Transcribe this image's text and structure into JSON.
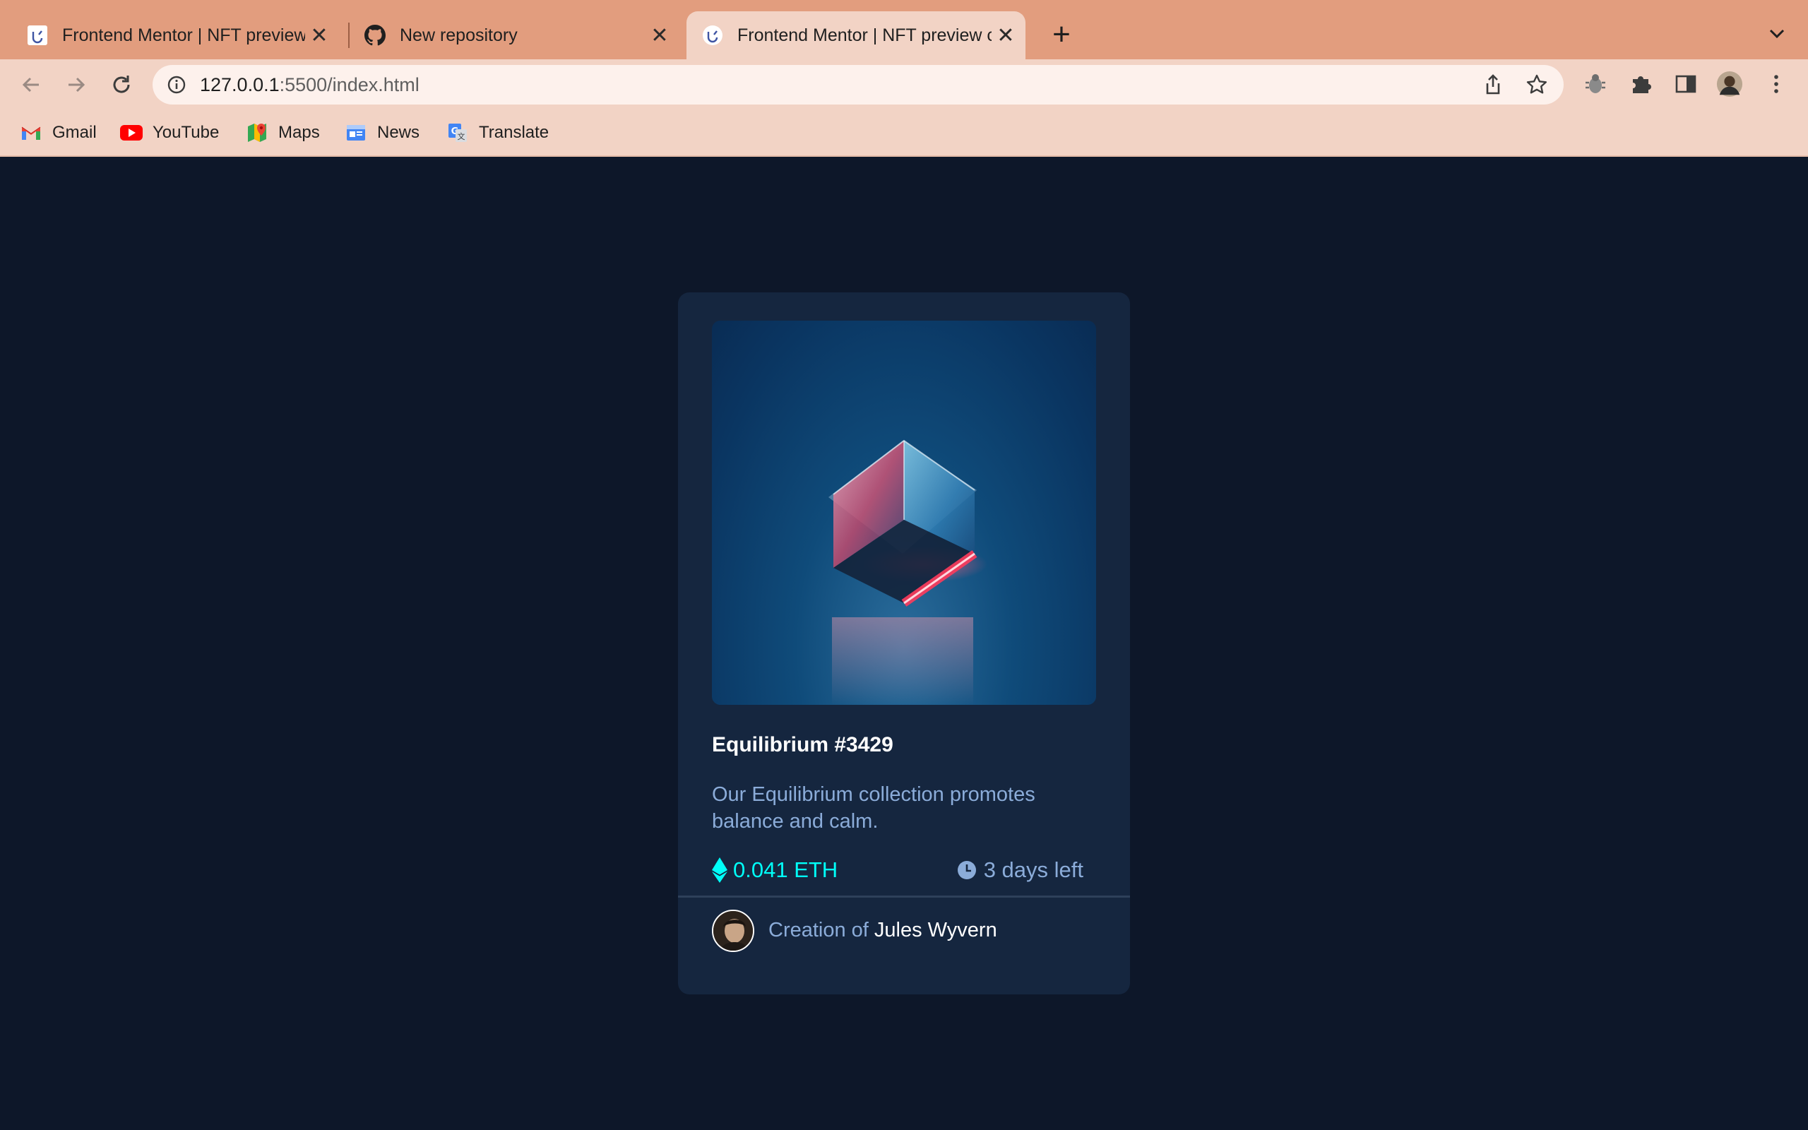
{
  "browser": {
    "tabs": [
      {
        "title": "Frontend Mentor | NFT preview card component",
        "active": false,
        "favicon": "frontend-mentor-icon"
      },
      {
        "title": "New repository",
        "active": false,
        "favicon": "github-icon"
      },
      {
        "title": "Frontend Mentor | NFT preview card component",
        "active": true,
        "favicon": "frontend-mentor-icon"
      }
    ],
    "url_host": "127.0.0.1",
    "url_rest": ":5500/index.html",
    "bookmarks": [
      {
        "label": "Gmail",
        "icon": "gmail-icon"
      },
      {
        "label": "YouTube",
        "icon": "youtube-icon"
      },
      {
        "label": "Maps",
        "icon": "maps-icon"
      },
      {
        "label": "News",
        "icon": "news-icon"
      },
      {
        "label": "Translate",
        "icon": "translate-icon"
      }
    ],
    "colors": {
      "frame": "#e29d7e",
      "toolbar": "#f2d3c5"
    }
  },
  "card": {
    "title": "Equilibrium #3429",
    "description": "Our Equilibrium collection promotes balance and calm.",
    "price": "0.041 ETH",
    "time_left": "3 days left",
    "creation_prefix": "Creation of",
    "creator_name": "Jules Wyvern",
    "colors": {
      "page_bg": "#0d1729",
      "card_bg": "#15263f",
      "cyan": "#00fff8",
      "soft_blue": "#8bacd9"
    }
  }
}
